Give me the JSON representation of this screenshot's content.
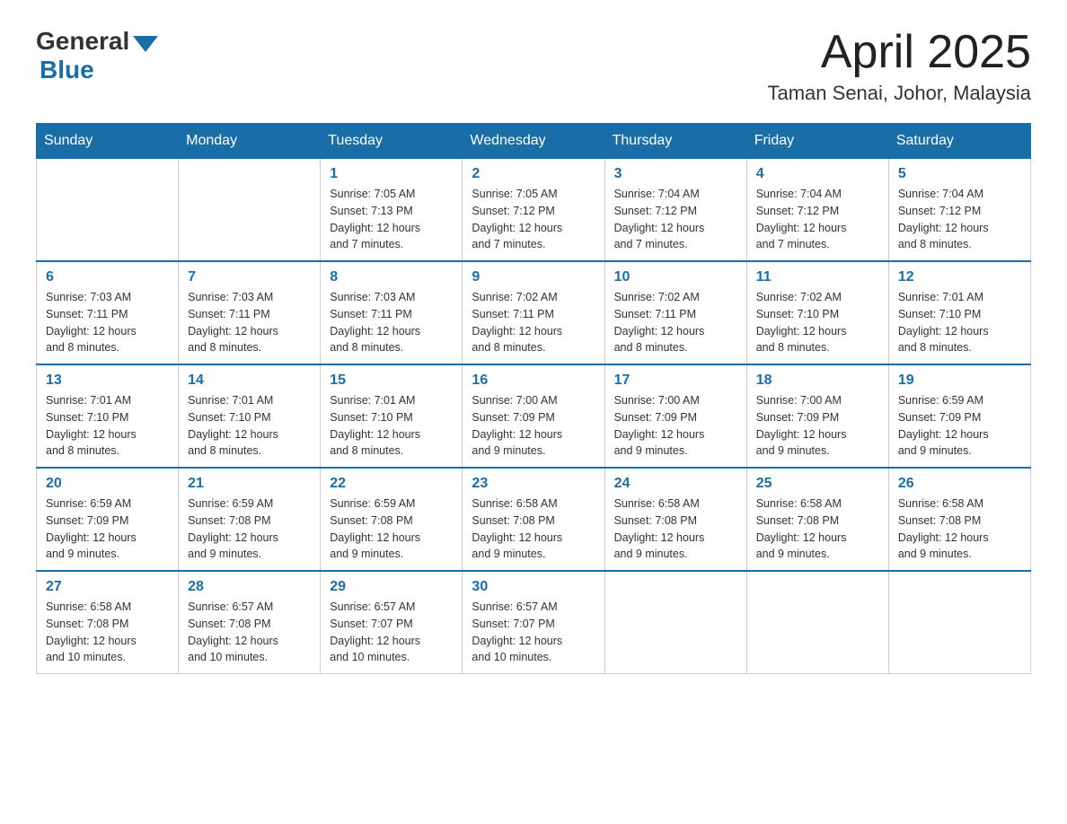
{
  "header": {
    "logo_general": "General",
    "logo_blue": "Blue",
    "month_title": "April 2025",
    "location": "Taman Senai, Johor, Malaysia"
  },
  "days_of_week": [
    "Sunday",
    "Monday",
    "Tuesday",
    "Wednesday",
    "Thursday",
    "Friday",
    "Saturday"
  ],
  "weeks": [
    [
      {
        "day": "",
        "info": ""
      },
      {
        "day": "",
        "info": ""
      },
      {
        "day": "1",
        "info": "Sunrise: 7:05 AM\nSunset: 7:13 PM\nDaylight: 12 hours\nand 7 minutes."
      },
      {
        "day": "2",
        "info": "Sunrise: 7:05 AM\nSunset: 7:12 PM\nDaylight: 12 hours\nand 7 minutes."
      },
      {
        "day": "3",
        "info": "Sunrise: 7:04 AM\nSunset: 7:12 PM\nDaylight: 12 hours\nand 7 minutes."
      },
      {
        "day": "4",
        "info": "Sunrise: 7:04 AM\nSunset: 7:12 PM\nDaylight: 12 hours\nand 7 minutes."
      },
      {
        "day": "5",
        "info": "Sunrise: 7:04 AM\nSunset: 7:12 PM\nDaylight: 12 hours\nand 8 minutes."
      }
    ],
    [
      {
        "day": "6",
        "info": "Sunrise: 7:03 AM\nSunset: 7:11 PM\nDaylight: 12 hours\nand 8 minutes."
      },
      {
        "day": "7",
        "info": "Sunrise: 7:03 AM\nSunset: 7:11 PM\nDaylight: 12 hours\nand 8 minutes."
      },
      {
        "day": "8",
        "info": "Sunrise: 7:03 AM\nSunset: 7:11 PM\nDaylight: 12 hours\nand 8 minutes."
      },
      {
        "day": "9",
        "info": "Sunrise: 7:02 AM\nSunset: 7:11 PM\nDaylight: 12 hours\nand 8 minutes."
      },
      {
        "day": "10",
        "info": "Sunrise: 7:02 AM\nSunset: 7:11 PM\nDaylight: 12 hours\nand 8 minutes."
      },
      {
        "day": "11",
        "info": "Sunrise: 7:02 AM\nSunset: 7:10 PM\nDaylight: 12 hours\nand 8 minutes."
      },
      {
        "day": "12",
        "info": "Sunrise: 7:01 AM\nSunset: 7:10 PM\nDaylight: 12 hours\nand 8 minutes."
      }
    ],
    [
      {
        "day": "13",
        "info": "Sunrise: 7:01 AM\nSunset: 7:10 PM\nDaylight: 12 hours\nand 8 minutes."
      },
      {
        "day": "14",
        "info": "Sunrise: 7:01 AM\nSunset: 7:10 PM\nDaylight: 12 hours\nand 8 minutes."
      },
      {
        "day": "15",
        "info": "Sunrise: 7:01 AM\nSunset: 7:10 PM\nDaylight: 12 hours\nand 8 minutes."
      },
      {
        "day": "16",
        "info": "Sunrise: 7:00 AM\nSunset: 7:09 PM\nDaylight: 12 hours\nand 9 minutes."
      },
      {
        "day": "17",
        "info": "Sunrise: 7:00 AM\nSunset: 7:09 PM\nDaylight: 12 hours\nand 9 minutes."
      },
      {
        "day": "18",
        "info": "Sunrise: 7:00 AM\nSunset: 7:09 PM\nDaylight: 12 hours\nand 9 minutes."
      },
      {
        "day": "19",
        "info": "Sunrise: 6:59 AM\nSunset: 7:09 PM\nDaylight: 12 hours\nand 9 minutes."
      }
    ],
    [
      {
        "day": "20",
        "info": "Sunrise: 6:59 AM\nSunset: 7:09 PM\nDaylight: 12 hours\nand 9 minutes."
      },
      {
        "day": "21",
        "info": "Sunrise: 6:59 AM\nSunset: 7:08 PM\nDaylight: 12 hours\nand 9 minutes."
      },
      {
        "day": "22",
        "info": "Sunrise: 6:59 AM\nSunset: 7:08 PM\nDaylight: 12 hours\nand 9 minutes."
      },
      {
        "day": "23",
        "info": "Sunrise: 6:58 AM\nSunset: 7:08 PM\nDaylight: 12 hours\nand 9 minutes."
      },
      {
        "day": "24",
        "info": "Sunrise: 6:58 AM\nSunset: 7:08 PM\nDaylight: 12 hours\nand 9 minutes."
      },
      {
        "day": "25",
        "info": "Sunrise: 6:58 AM\nSunset: 7:08 PM\nDaylight: 12 hours\nand 9 minutes."
      },
      {
        "day": "26",
        "info": "Sunrise: 6:58 AM\nSunset: 7:08 PM\nDaylight: 12 hours\nand 9 minutes."
      }
    ],
    [
      {
        "day": "27",
        "info": "Sunrise: 6:58 AM\nSunset: 7:08 PM\nDaylight: 12 hours\nand 10 minutes."
      },
      {
        "day": "28",
        "info": "Sunrise: 6:57 AM\nSunset: 7:08 PM\nDaylight: 12 hours\nand 10 minutes."
      },
      {
        "day": "29",
        "info": "Sunrise: 6:57 AM\nSunset: 7:07 PM\nDaylight: 12 hours\nand 10 minutes."
      },
      {
        "day": "30",
        "info": "Sunrise: 6:57 AM\nSunset: 7:07 PM\nDaylight: 12 hours\nand 10 minutes."
      },
      {
        "day": "",
        "info": ""
      },
      {
        "day": "",
        "info": ""
      },
      {
        "day": "",
        "info": ""
      }
    ]
  ]
}
